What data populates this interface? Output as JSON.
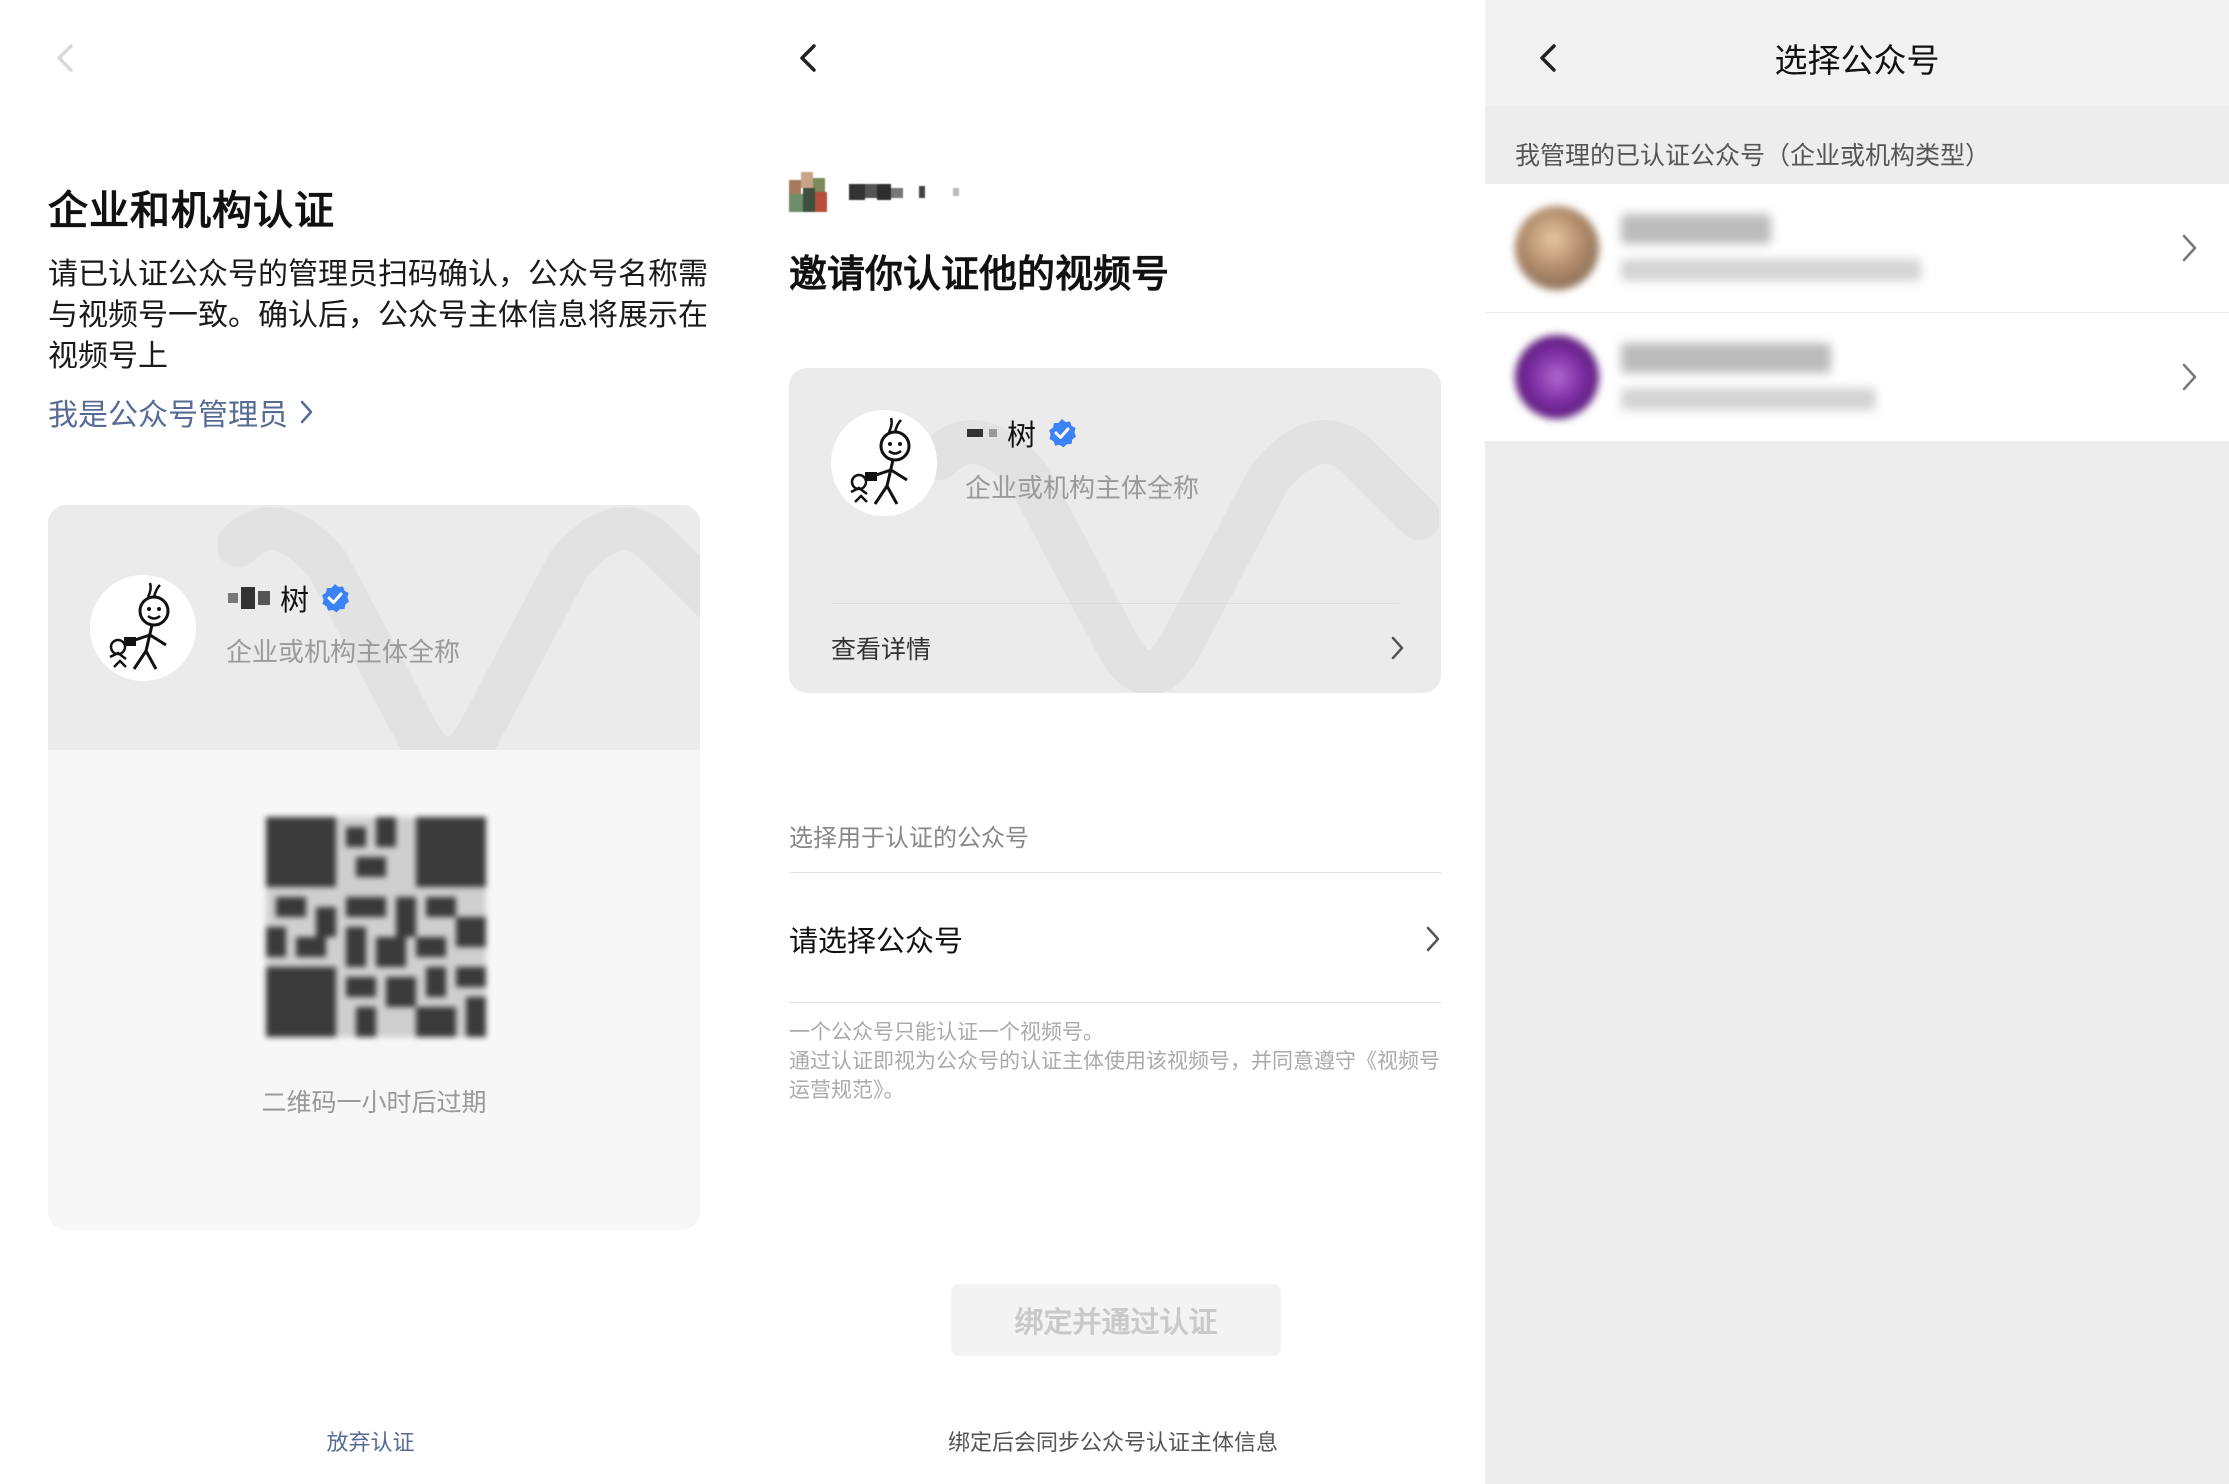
{
  "panel1": {
    "title": "企业和机构认证",
    "description": "请已认证公众号的管理员扫码确认，公众号名称需与视频号一致。确认后，公众号主体信息将展示在视频号上",
    "admin_link": "我是公众号管理员",
    "account_name_visible": "树",
    "account_subtitle": "企业或机构主体全称",
    "qr_note": "二维码一小时后过期",
    "abandon_label": "放弃认证"
  },
  "panel2": {
    "title": "邀请你认证他的视频号",
    "account_name_visible": "树",
    "account_subtitle": "企业或机构主体全称",
    "detail_label": "查看详情",
    "section_label": "选择用于认证的公众号",
    "select_placeholder": "请选择公众号",
    "notes": "一个公众号只能认证一个视频号。\n通过认证即视为公众号的认证主体使用该视频号，并同意遵守《视频号运营规范》。",
    "bind_button": "绑定并通过认证",
    "bind_note": "绑定后会同步公众号认证主体信息"
  },
  "panel3": {
    "header_title": "选择公众号",
    "section_label": "我管理的已认证公众号（企业或机构类型）",
    "accounts_count": 2
  },
  "colors": {
    "link": "#576b95",
    "verified": "#3b82f6",
    "muted": "#9a9a9a",
    "disabled_button_bg": "#f3f3f3"
  },
  "icons": [
    "back-chevron-icon",
    "chevron-right-icon",
    "verified-badge-icon",
    "stick-figure-avatar-icon",
    "qr-code-icon"
  ]
}
